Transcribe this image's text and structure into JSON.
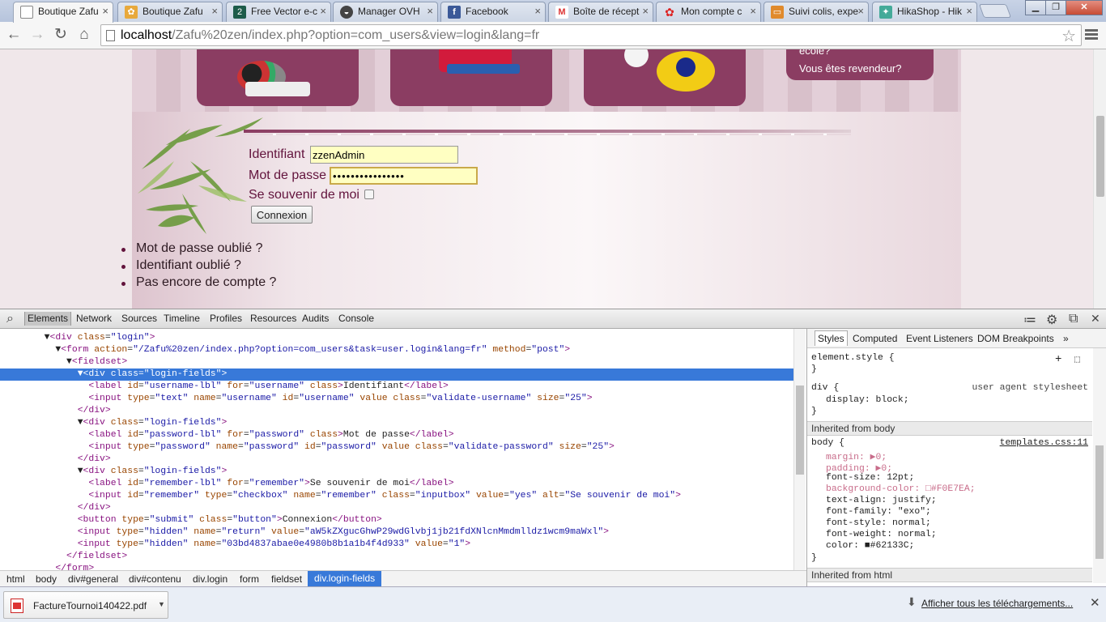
{
  "tabs": [
    {
      "title": "Boutique Zafu",
      "icon": "page-icon",
      "active": true
    },
    {
      "title": "Boutique Zafu",
      "icon": "joomla-icon"
    },
    {
      "title": "Free Vector e-c",
      "icon": "vector-icon"
    },
    {
      "title": "Manager OVH",
      "icon": "ovh-icon"
    },
    {
      "title": "Facebook",
      "icon": "facebook-icon"
    },
    {
      "title": "Boîte de récept",
      "icon": "gmail-icon"
    },
    {
      "title": "Mon compte c",
      "icon": "flower-icon"
    },
    {
      "title": "Suivi colis, expe",
      "icon": "tracking-icon"
    },
    {
      "title": "HikaShop - Hik",
      "icon": "hikashop-icon"
    }
  ],
  "address": {
    "host": "localhost",
    "path": "/Zafu%20zen/index.php?option=com_users&view=login&lang=fr"
  },
  "site": {
    "promo": {
      "line1": "école?",
      "line2": "Vous êtes revendeur?"
    },
    "login": {
      "username_label": "Identifiant",
      "username_value": "zzenAdmin",
      "password_label": "Mot de passe",
      "password_value": "••••••••••••••••",
      "remember_label": "Se souvenir de moi",
      "submit_label": "Connexion"
    },
    "links": [
      "Mot de passe oublié ?",
      "Identifiant oublié ?",
      "Pas encore de compte ?"
    ]
  },
  "devtools": {
    "tabs": [
      "Elements",
      "Network",
      "Sources",
      "Timeline",
      "Profiles",
      "Resources",
      "Audits",
      "Console"
    ],
    "breadcrumbs": [
      "html",
      "body",
      "div#general",
      "div#contenu",
      "div.login",
      "form",
      "fieldset",
      "div.login-fields"
    ],
    "styles_tabs": [
      "Styles",
      "Computed",
      "Event Listeners",
      "DOM Breakpoints"
    ],
    "styles": {
      "element_style": "element.style {",
      "div_rule": "div {",
      "div_source": "user agent stylesheet",
      "div_prop": "display: block;",
      "inherited_body": "Inherited from body",
      "body_rule": "body {",
      "body_source": "templates.css:11",
      "body_props": [
        "margin: ▶0;",
        "padding: ▶0;",
        "font-size: 12pt;",
        "background-color: □#F0E7EA;",
        "text-align: justify;",
        "font-family: \"exo\";",
        "font-style: normal;",
        "font-weight: normal;",
        "color: ■#62133C;"
      ],
      "inherited_html": "Inherited from html"
    }
  },
  "downloads": {
    "file": "FactureTournoi140422.pdf",
    "show_all": "Afficher tous les téléchargements..."
  },
  "colors": {
    "brand": "#62133C",
    "page_bg": "#F0E7EA",
    "selection": "#3879D9"
  }
}
